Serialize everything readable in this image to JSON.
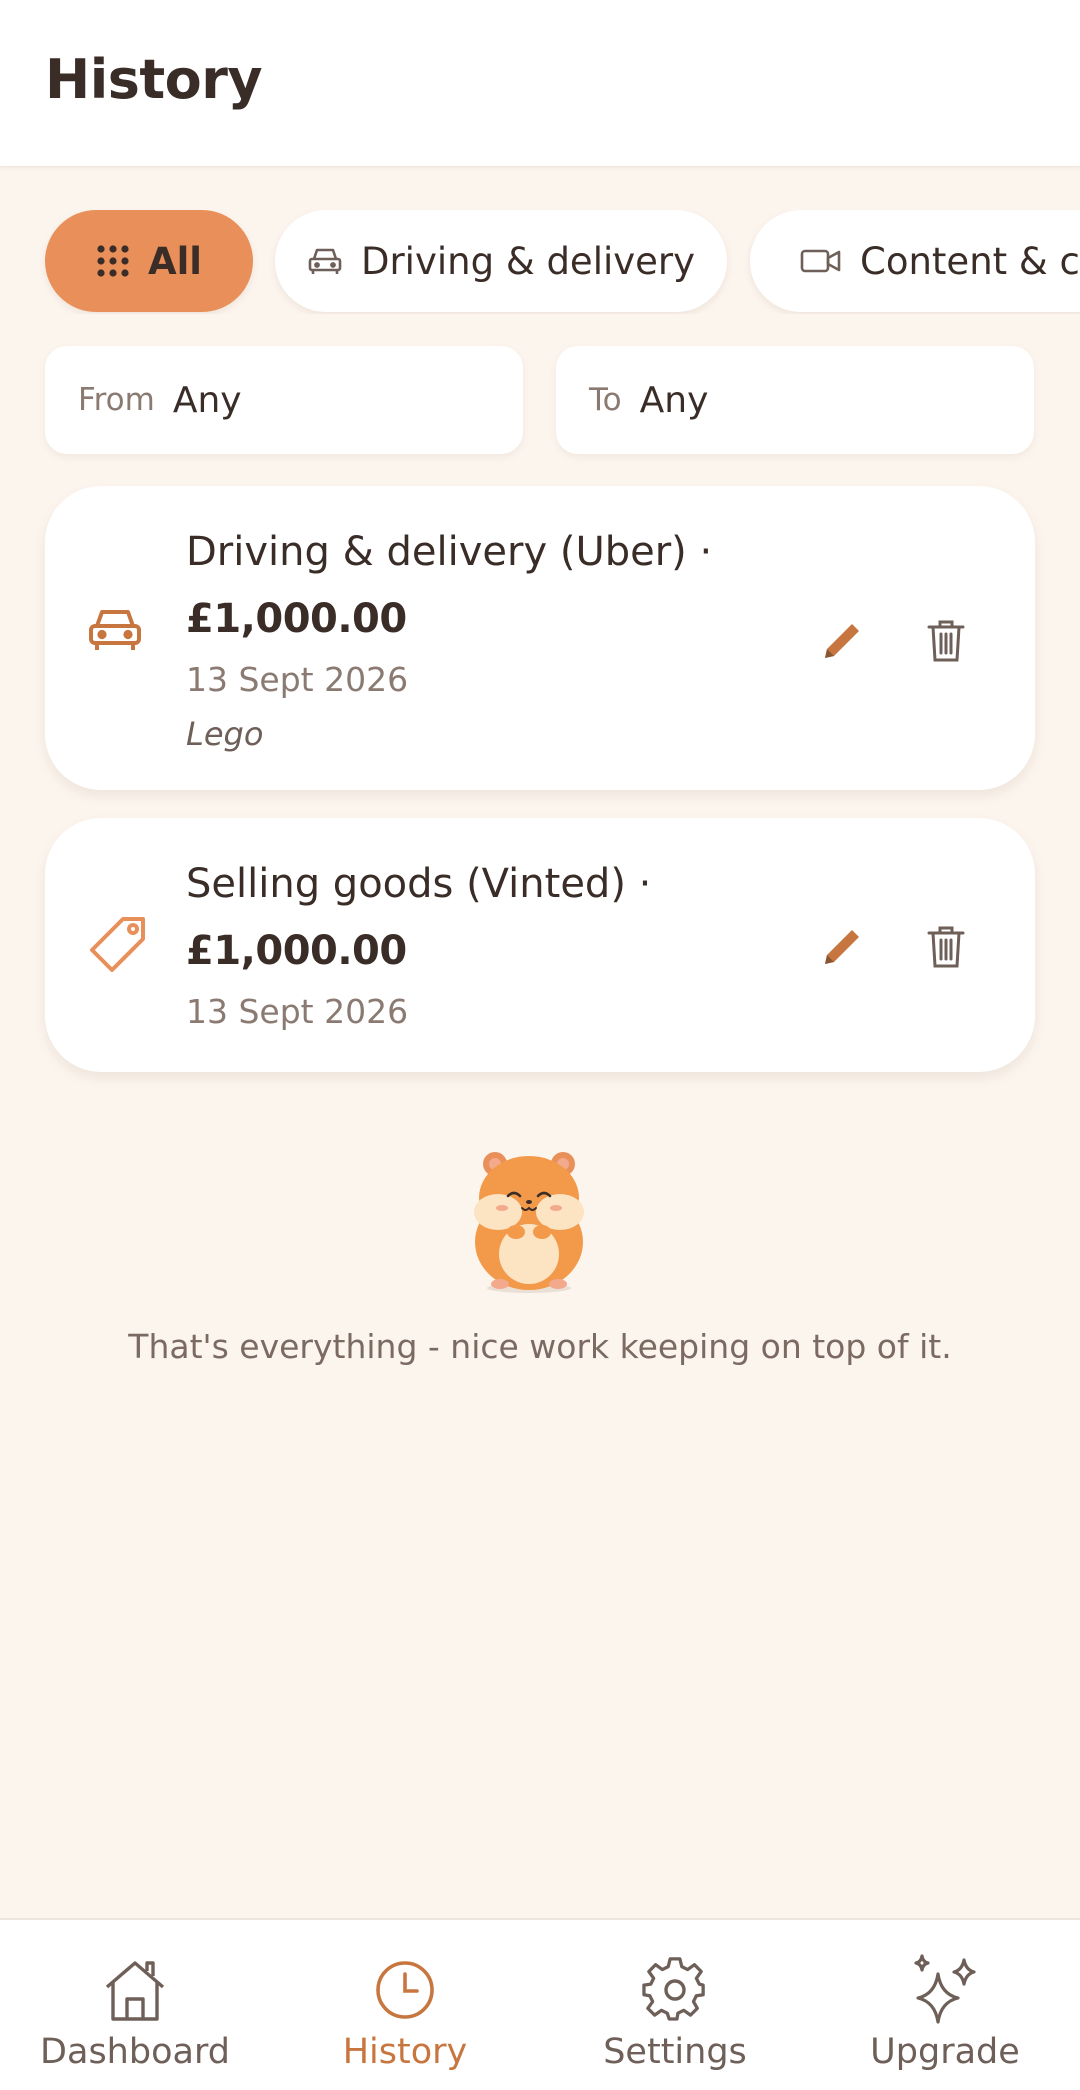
{
  "header": {
    "title": "History"
  },
  "filters": {
    "chips": [
      {
        "label": "All",
        "icon": "grid-icon",
        "active": true
      },
      {
        "label": "Driving & delivery",
        "icon": "car-icon",
        "active": false
      },
      {
        "label": "Content & cre",
        "icon": "video-camera-icon",
        "active": false
      }
    ],
    "date_from": {
      "label": "From",
      "value": "Any"
    },
    "date_to": {
      "label": "To",
      "value": "Any"
    }
  },
  "entries": [
    {
      "title": "Driving & delivery (Uber) ·",
      "amount": "£1,000.00",
      "date": "13 Sept 2026",
      "note": "Lego",
      "icon": "car-icon"
    },
    {
      "title": "Selling goods (Vinted) ·",
      "amount": "£1,000.00",
      "date": "13 Sept 2026",
      "icon": "tag-icon"
    }
  ],
  "empty_state": {
    "message": "That's everything - nice work keeping on top of it."
  },
  "bottom_nav": {
    "items": [
      {
        "label": "Dashboard",
        "icon": "home-icon",
        "active": false
      },
      {
        "label": "History",
        "icon": "clock-icon",
        "active": true
      },
      {
        "label": "Settings",
        "icon": "gear-icon",
        "active": false
      },
      {
        "label": "Upgrade",
        "icon": "sparkles-icon",
        "active": false
      }
    ]
  },
  "colors": {
    "accent": "#E9905A",
    "accent_dark": "#C8763F",
    "background": "#FCF5EE",
    "text": "#3A2D28",
    "muted": "#8A7A72"
  }
}
